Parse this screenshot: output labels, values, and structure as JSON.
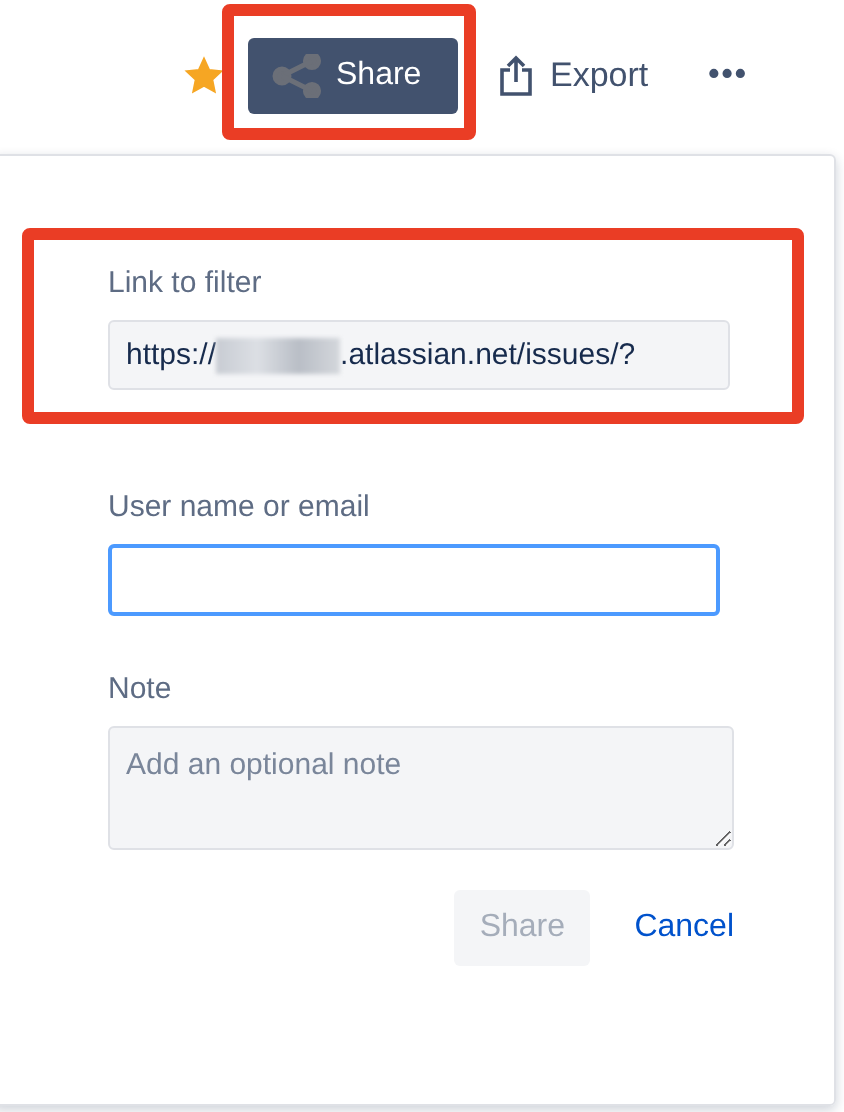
{
  "toolbar": {
    "starred": true,
    "share_button": {
      "label": "Share",
      "highlighted": true
    },
    "export_button": {
      "label": "Export"
    },
    "more_button": {
      "label": "•••"
    }
  },
  "share_dialog": {
    "link": {
      "label": "Link to filter",
      "value_start": "https://",
      "value_end": ".atlassian.net/issues/?",
      "redacted": true,
      "highlighted": true
    },
    "user": {
      "label": "User name or email",
      "focused": true
    },
    "note": {
      "label": "Note",
      "placeholder": "Add an optional note"
    },
    "buttons": [
      {
        "label": "Share",
        "kind": "primary",
        "disabled": true
      },
      {
        "label": "Cancel",
        "kind": "link",
        "disabled": false
      }
    ]
  }
}
